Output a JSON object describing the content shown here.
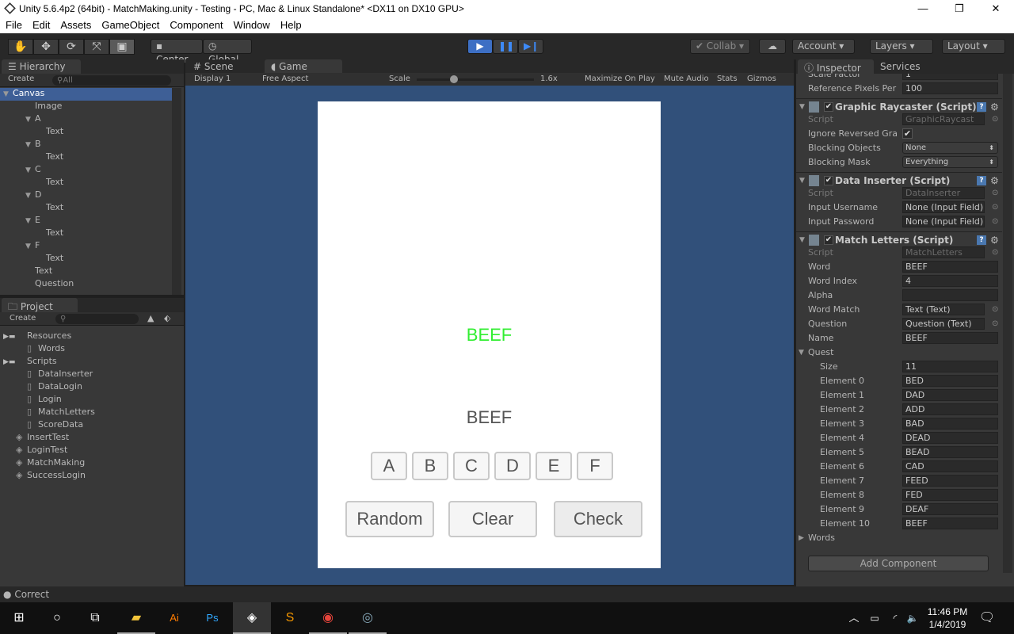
{
  "window": {
    "title": "Unity 5.6.4p2 (64bit) - MatchMaking.unity - Testing - PC, Mac & Linux Standalone* <DX11 on DX10 GPU>",
    "minimize": "—",
    "maximize": "❐",
    "close": "✕"
  },
  "menu": [
    "File",
    "Edit",
    "Assets",
    "GameObject",
    "Component",
    "Window",
    "Help"
  ],
  "toolbar": {
    "center": "Center",
    "global": "Global",
    "collab": "Collab",
    "account": "Account",
    "layers": "Layers",
    "layout": "Layout"
  },
  "hierarchy": {
    "tab": "Hierarchy",
    "create": "Create",
    "search_placeholder": "All",
    "items": [
      {
        "label": "Canvas",
        "depth": 0,
        "arrow": true,
        "selected": true
      },
      {
        "label": "Image",
        "depth": 1
      },
      {
        "label": "A",
        "depth": 1,
        "arrow": true
      },
      {
        "label": "Text",
        "depth": 2
      },
      {
        "label": "B",
        "depth": 1,
        "arrow": true
      },
      {
        "label": "Text",
        "depth": 2
      },
      {
        "label": "C",
        "depth": 1,
        "arrow": true
      },
      {
        "label": "Text",
        "depth": 2
      },
      {
        "label": "D",
        "depth": 1,
        "arrow": true
      },
      {
        "label": "Text",
        "depth": 2
      },
      {
        "label": "E",
        "depth": 1,
        "arrow": true
      },
      {
        "label": "Text",
        "depth": 2
      },
      {
        "label": "F",
        "depth": 1,
        "arrow": true
      },
      {
        "label": "Text",
        "depth": 2
      },
      {
        "label": "Text",
        "depth": 1
      },
      {
        "label": "Question",
        "depth": 1
      }
    ]
  },
  "project": {
    "tab": "Project",
    "create": "Create",
    "items": [
      {
        "label": "Resources",
        "depth": 0,
        "type": "folder"
      },
      {
        "label": "Words",
        "depth": 1,
        "type": "file"
      },
      {
        "label": "Scripts",
        "depth": 0,
        "type": "folder"
      },
      {
        "label": "DataInserter",
        "depth": 1,
        "type": "file"
      },
      {
        "label": "DataLogin",
        "depth": 1,
        "type": "file"
      },
      {
        "label": "Login",
        "depth": 1,
        "type": "file"
      },
      {
        "label": "MatchLetters",
        "depth": 1,
        "type": "file"
      },
      {
        "label": "ScoreData",
        "depth": 1,
        "type": "file"
      },
      {
        "label": "InsertTest",
        "depth": 0,
        "type": "scene"
      },
      {
        "label": "LoginTest",
        "depth": 0,
        "type": "scene"
      },
      {
        "label": "MatchMaking",
        "depth": 0,
        "type": "scene"
      },
      {
        "label": "SuccessLogin",
        "depth": 0,
        "type": "scene"
      }
    ]
  },
  "game_view": {
    "tab_scene": "Scene",
    "tab_game": "Game",
    "display": "Display 1",
    "aspect": "Free Aspect",
    "scale_label": "Scale",
    "scale_value": "1.6x",
    "maximize": "Maximize On Play",
    "mute": "Mute Audio",
    "stats": "Stats",
    "gizmos": "Gizmos",
    "background": "#31507a"
  },
  "game": {
    "word_match": "BEEF",
    "word_match_color": "#33ee33",
    "question": "BEEF",
    "letters": [
      "A",
      "B",
      "C",
      "D",
      "E",
      "F"
    ],
    "buttons": [
      "Random",
      "Clear",
      "Check"
    ]
  },
  "inspector": {
    "tab": "Inspector",
    "services": "Services",
    "top_rows": [
      {
        "label": "Scale Factor",
        "value": "1"
      },
      {
        "label": "Reference Pixels Per",
        "value": "100"
      }
    ],
    "graphic_raycaster": {
      "title": "Graphic Raycaster (Script)",
      "script": "GraphicRaycast",
      "ignore_label": "Ignore Reversed Gra",
      "ignore_checked": true,
      "blocking_objects_label": "Blocking Objects",
      "blocking_objects": "None",
      "blocking_mask_label": "Blocking Mask",
      "blocking_mask": "Everything"
    },
    "data_inserter": {
      "title": "Data Inserter (Script)",
      "script": "DataInserter",
      "rows": [
        {
          "label": "Input Username",
          "value": "None (Input Field)"
        },
        {
          "label": "Input Password",
          "value": "None (Input Field)"
        }
      ]
    },
    "match_letters": {
      "title": "Match Letters (Script)",
      "script": "MatchLetters",
      "rows": [
        {
          "label": "Word",
          "value": "BEEF"
        },
        {
          "label": "Word Index",
          "value": "4"
        },
        {
          "label": "Alpha",
          "value": ""
        }
      ],
      "word_match_label": "Word Match",
      "word_match": "Text (Text)",
      "question_label": "Question",
      "question": "Question (Text)",
      "name_label": "Name",
      "name": "BEEF",
      "quest_label": "Quest",
      "size_label": "Size",
      "size": "11",
      "quest": [
        "BED",
        "DAD",
        "ADD",
        "BAD",
        "DEAD",
        "BEAD",
        "CAD",
        "FEED",
        "FED",
        "DEAF",
        "BEEF"
      ],
      "words_label": "Words"
    },
    "script_label": "Script",
    "add_component": "Add Component"
  },
  "status": {
    "message": "Correct"
  },
  "taskbar": {
    "time": "11:46 PM",
    "date": "1/4/2019"
  }
}
